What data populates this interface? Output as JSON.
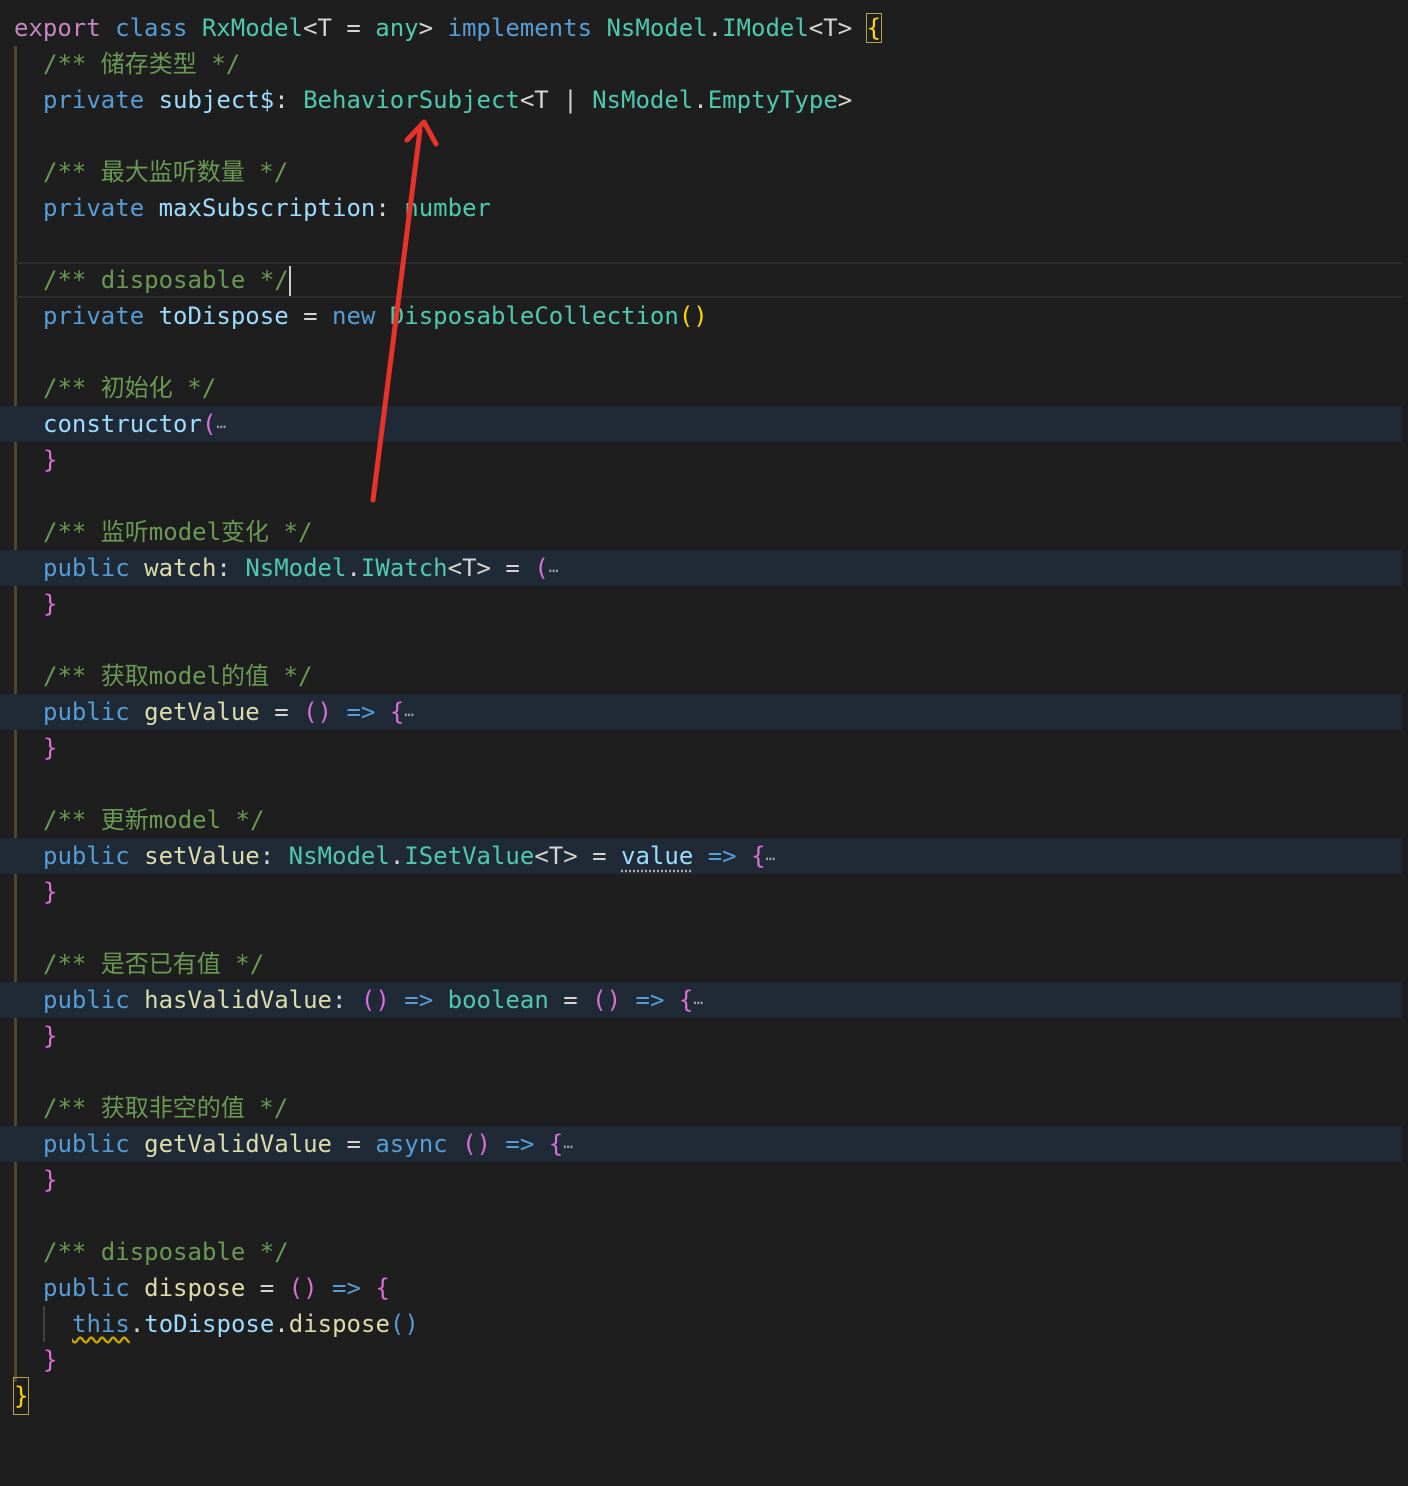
{
  "class_decl": {
    "export_kw": "export",
    "class_kw": "class",
    "class_name": "RxModel",
    "generic": "<T = ",
    "generic_default": "any",
    "generic_close": ">",
    "implements_kw": "implements",
    "iface_ns": "NsModel",
    "iface_name": "IModel",
    "iface_generic": "<T>",
    "open_brace": "{",
    "close_brace": "}"
  },
  "members": {
    "subject": {
      "comment": "/** 储存类型 */",
      "modifier": "private",
      "name": "subject$",
      "type_name": "BehaviorSubject",
      "type_rest": "<T | ",
      "ns": "NsModel",
      "type2": "EmptyType",
      "type_close": ">"
    },
    "max_sub": {
      "comment": "/** 最大监听数量 */",
      "modifier": "private",
      "name": "maxSubscription",
      "type": "number"
    },
    "to_dispose": {
      "comment": "/** disposable */",
      "modifier": "private",
      "name": "toDispose",
      "new_kw": "new",
      "type": "DisposableCollection",
      "parens": "()"
    },
    "ctor": {
      "comment": "/** 初始化 */",
      "name": "constructor",
      "paren": "(",
      "ellipsis": "⋯",
      "close": "}"
    },
    "watch": {
      "comment": "/** 监听model变化 */",
      "modifier": "public",
      "name": "watch",
      "ns": "NsModel",
      "type": "IWatch",
      "generic": "<T>",
      "assign": " = ",
      "paren": "(",
      "ellipsis": "⋯",
      "close": "}"
    },
    "get_value": {
      "comment": "/** 获取model的值 */",
      "modifier": "public",
      "name": "getValue",
      "assign": " = ",
      "parens": "()",
      "arrow": "=>",
      "brace": "{",
      "ellipsis": "⋯",
      "close": "}"
    },
    "set_value": {
      "comment": "/** 更新model */",
      "modifier": "public",
      "name": "setValue",
      "ns": "NsModel",
      "type": "ISetValue",
      "generic": "<T>",
      "assign": " = ",
      "param": "value",
      "arrow": "=>",
      "brace": "{",
      "ellipsis": "⋯",
      "close": "}"
    },
    "has_valid": {
      "comment": "/** 是否已有值 */",
      "modifier": "public",
      "name": "hasValidValue",
      "parens": "()",
      "arrow": "=>",
      "ret_type": "boolean",
      "assign": " = ",
      "parens2": "()",
      "arrow2": "=>",
      "brace": "{",
      "ellipsis": "⋯",
      "close": "}"
    },
    "get_valid": {
      "comment": "/** 获取非空的值 */",
      "modifier": "public",
      "name": "getValidValue",
      "assign": " = ",
      "async_kw": "async",
      "parens": "()",
      "arrow": "=>",
      "brace": "{",
      "ellipsis": "⋯",
      "close": "}"
    },
    "dispose": {
      "comment": "/** disposable */",
      "modifier": "public",
      "name": "dispose",
      "assign": " = ",
      "parens": "()",
      "arrow": "=>",
      "brace": "{",
      "this_kw": "this",
      "prop": "toDispose",
      "method": "dispose",
      "call": "()",
      "close": "}"
    }
  },
  "colors": {
    "background": "#1e1e1e",
    "annotation_arrow": "#e8332a"
  }
}
